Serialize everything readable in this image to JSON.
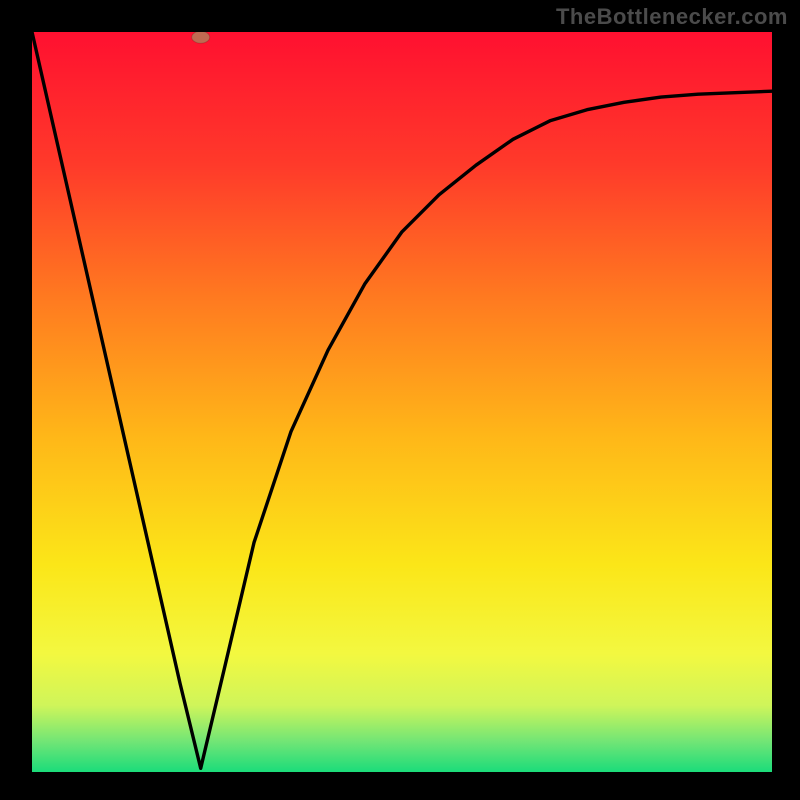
{
  "attribution": "TheBottlenecker.com",
  "gradient": {
    "stops": [
      {
        "offset": 0.0,
        "color": "#ff1030"
      },
      {
        "offset": 0.18,
        "color": "#ff3a2a"
      },
      {
        "offset": 0.36,
        "color": "#ff7a20"
      },
      {
        "offset": 0.55,
        "color": "#ffb818"
      },
      {
        "offset": 0.72,
        "color": "#fbe618"
      },
      {
        "offset": 0.84,
        "color": "#f3f840"
      },
      {
        "offset": 0.91,
        "color": "#cff55a"
      },
      {
        "offset": 0.96,
        "color": "#6fe576"
      },
      {
        "offset": 1.0,
        "color": "#1bdc7a"
      }
    ]
  },
  "marker": {
    "x_ratio": 0.228,
    "y_ratio": 0.993,
    "rx": 9,
    "ry": 6
  },
  "chart_data": {
    "type": "line",
    "title": "",
    "xlabel": "",
    "ylabel": "",
    "xlim_ratio": [
      0,
      1
    ],
    "ylim_ratio": [
      0,
      1
    ],
    "series": [
      {
        "name": "bottleneck-curve",
        "x_ratio": [
          0.0,
          0.05,
          0.1,
          0.15,
          0.2,
          0.228,
          0.26,
          0.3,
          0.35,
          0.4,
          0.45,
          0.5,
          0.55,
          0.6,
          0.65,
          0.7,
          0.75,
          0.8,
          0.85,
          0.9,
          0.95,
          1.0
        ],
        "y_ratio": [
          1.0,
          0.78,
          0.56,
          0.34,
          0.12,
          0.005,
          0.14,
          0.31,
          0.46,
          0.57,
          0.66,
          0.73,
          0.78,
          0.82,
          0.855,
          0.88,
          0.895,
          0.905,
          0.912,
          0.916,
          0.918,
          0.92
        ]
      }
    ],
    "annotations": []
  }
}
